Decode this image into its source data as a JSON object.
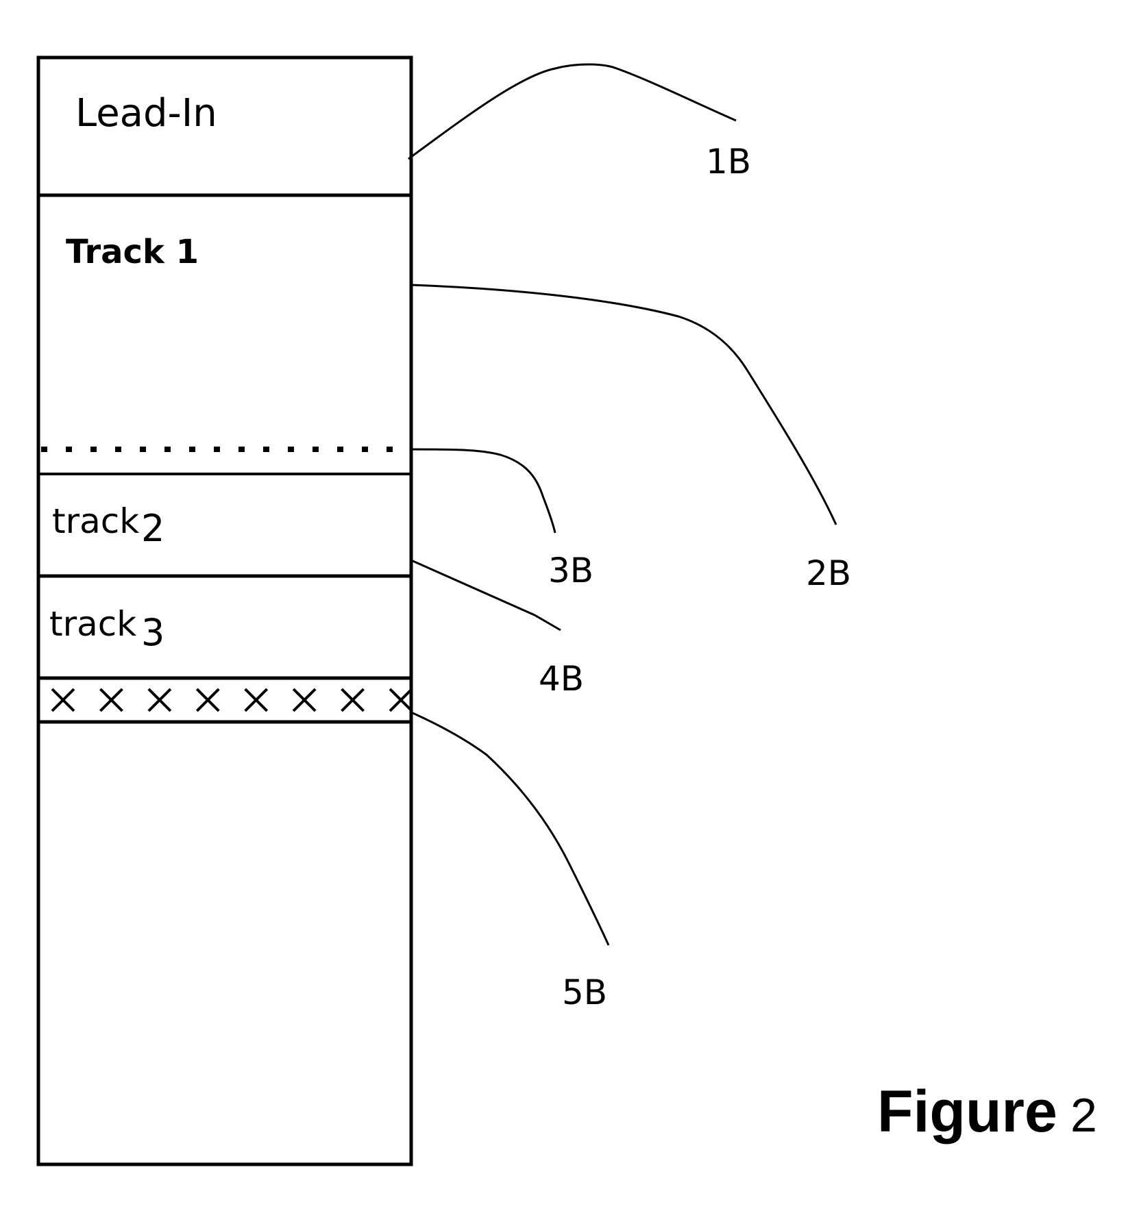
{
  "figure": {
    "title": "Figure",
    "number": "2"
  },
  "regions": [
    {
      "id": "lead-in",
      "label": "Lead-In"
    },
    {
      "id": "track-1",
      "label": "Track 1"
    },
    {
      "id": "track-1-end-boundary",
      "label": "",
      "style": "dotted"
    },
    {
      "id": "track-2",
      "label": "track"
    },
    {
      "id": "track-3",
      "label": "track"
    },
    {
      "id": "x-strip",
      "label": "",
      "mark": "X",
      "mark_count": 8
    },
    {
      "id": "unrecorded-area",
      "label": ""
    }
  ],
  "track_numbers": {
    "track2": "2",
    "track3": "3"
  },
  "references": [
    {
      "id": "1B",
      "label": "1B",
      "points_to": "lead-in"
    },
    {
      "id": "2B",
      "label": "2B",
      "points_to": "track-1"
    },
    {
      "id": "3B",
      "label": "3B",
      "points_to": "track-1-end-boundary"
    },
    {
      "id": "4B",
      "label": "4B",
      "points_to": "track-2"
    },
    {
      "id": "5B",
      "label": "5B",
      "points_to": "x-strip"
    }
  ]
}
